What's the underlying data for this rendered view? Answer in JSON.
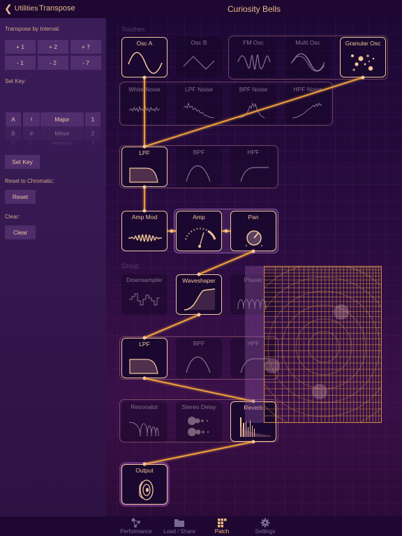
{
  "app": {
    "title": "Curiosity Bells"
  },
  "left_panel": {
    "back_label": "Utilities",
    "title": "Transpose",
    "transpose_label": "Transpose by Interval:",
    "interval_buttons": [
      "+ 1",
      "+ 2",
      "+ 7",
      "- 1",
      "- 2",
      "- 7"
    ],
    "set_key_label": "Set Key:",
    "key_picker": {
      "notes": [
        "A",
        "B",
        "C"
      ],
      "accidentals": [
        "♮",
        "#",
        "♭"
      ],
      "scales": [
        "Major",
        "Minor",
        "Harmonic"
      ],
      "octaves": [
        "1",
        "2",
        "3"
      ],
      "selected": {
        "note": "A",
        "accidental": "♮",
        "scale": "Major",
        "octave": "1"
      }
    },
    "set_key_button": "Set Key",
    "reset_label": "Reset to Chromatic:",
    "reset_button": "Reset",
    "clear_label": "Clear:",
    "clear_button": "Clear"
  },
  "patch": {
    "sections": {
      "touches": "Touches",
      "group": "Group"
    },
    "oscillators": [
      {
        "label": "Osc A",
        "active": true
      },
      {
        "label": "Osc B",
        "active": false
      },
      {
        "label": "FM Osc",
        "active": false
      },
      {
        "label": "Multi Osc",
        "active": false
      },
      {
        "label": "Granular Osc",
        "active": true
      }
    ],
    "noise": [
      {
        "label": "White Noise",
        "active": false
      },
      {
        "label": "LPF Noise",
        "active": false
      },
      {
        "label": "BPF Noise",
        "active": false
      },
      {
        "label": "HPF Noise",
        "active": false
      }
    ],
    "touch_filters": [
      {
        "label": "LPF",
        "active": true
      },
      {
        "label": "BPF",
        "active": false
      },
      {
        "label": "HPF",
        "active": false
      }
    ],
    "touch_amp": [
      {
        "label": "Amp Mod",
        "active": true
      },
      {
        "label": "Amp",
        "active": true
      },
      {
        "label": "Pan",
        "active": true
      }
    ],
    "group_fx": [
      {
        "label": "Downsampler",
        "active": false
      },
      {
        "label": "Waveshaper",
        "active": true
      },
      {
        "label": "Phaser",
        "active": false
      }
    ],
    "group_filters": [
      {
        "label": "LPF",
        "active": true
      },
      {
        "label": "BPF",
        "active": false
      },
      {
        "label": "HPF",
        "active": false
      }
    ],
    "group_time": [
      {
        "label": "Resonator",
        "active": false
      },
      {
        "label": "Stereo Delay",
        "active": false
      },
      {
        "label": "Reverb",
        "active": true
      }
    ],
    "output": {
      "label": "Output",
      "active": true
    }
  },
  "tabbar": {
    "tabs": [
      {
        "label": "Performance",
        "icon": "nodes-icon",
        "active": false
      },
      {
        "label": "Load / Share",
        "icon": "folder-icon",
        "active": false
      },
      {
        "label": "Patch",
        "icon": "grid-icon",
        "active": true
      },
      {
        "label": "Settings",
        "icon": "gear-icon",
        "active": false
      }
    ]
  },
  "colors": {
    "accent": "#f2c59a",
    "wire": "#f5a63c",
    "background": "#2a0c40",
    "panel": "#3a1c58"
  }
}
